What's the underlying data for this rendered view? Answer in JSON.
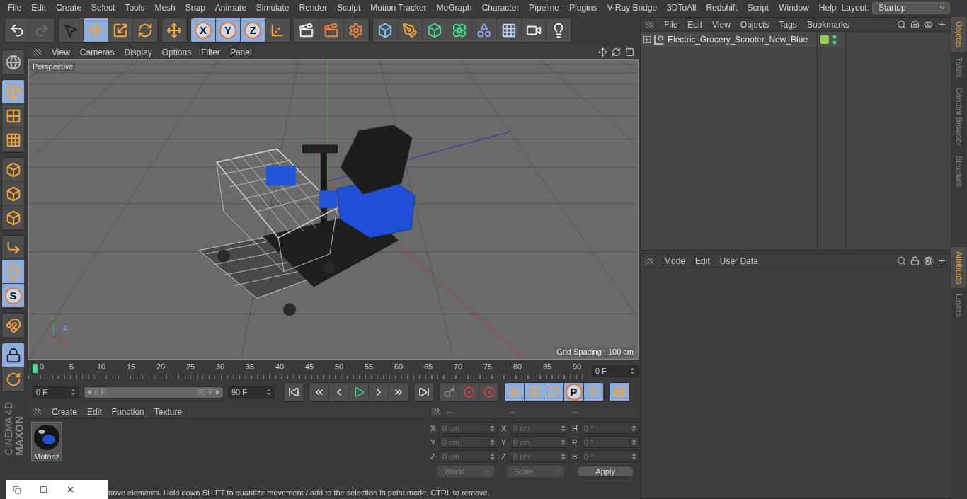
{
  "menu_bar": {
    "items": [
      "File",
      "Edit",
      "Create",
      "Select",
      "Tools",
      "Mesh",
      "Snap",
      "Animate",
      "Simulate",
      "Render",
      "Sculpt",
      "Motion Tracker",
      "MoGraph",
      "Character",
      "Pipeline",
      "Plugins",
      "V-Ray Bridge",
      "3DToAll",
      "Redshift",
      "Script",
      "Window",
      "Help"
    ],
    "layout_label": "Layout:",
    "layout_value": "Startup"
  },
  "toolbar": {
    "groups": [
      {
        "buttons": [
          {
            "kind": "undo",
            "selected": false
          },
          {
            "kind": "redo",
            "selected": false
          }
        ]
      },
      {
        "buttons": [
          {
            "kind": "select",
            "selected": false
          },
          {
            "kind": "move",
            "selected": true
          },
          {
            "kind": "scale",
            "selected": false
          },
          {
            "kind": "rotate",
            "selected": false
          }
        ]
      },
      {
        "buttons": [
          {
            "kind": "move",
            "selected": false
          }
        ]
      },
      {
        "buttons": [
          {
            "kind": "letter",
            "label": "X",
            "selected": true
          },
          {
            "kind": "letter",
            "label": "Y",
            "selected": true
          },
          {
            "kind": "letter",
            "label": "Z",
            "selected": true
          },
          {
            "kind": "coord",
            "selected": false
          }
        ]
      },
      {
        "buttons": [
          {
            "kind": "render-view",
            "selected": false
          },
          {
            "kind": "render-pic",
            "selected": false
          },
          {
            "kind": "render-settings",
            "selected": false
          }
        ]
      },
      {
        "buttons": [
          {
            "kind": "cube",
            "selected": false
          },
          {
            "kind": "pen",
            "selected": false
          },
          {
            "kind": "subdivision",
            "selected": false
          },
          {
            "kind": "cloner",
            "selected": false
          },
          {
            "kind": "deformer",
            "selected": false
          },
          {
            "kind": "floor",
            "selected": false
          },
          {
            "kind": "camera",
            "selected": false
          },
          {
            "kind": "light",
            "selected": false
          }
        ]
      }
    ]
  },
  "left_tools": {
    "groups": [
      {
        "buttons": [
          {
            "kind": "globe",
            "selected": false
          }
        ]
      },
      {
        "buttons": [
          {
            "kind": "model",
            "selected": true
          },
          {
            "kind": "texture",
            "selected": false
          },
          {
            "kind": "workplane",
            "selected": false
          }
        ]
      },
      {
        "buttons": [
          {
            "kind": "points",
            "selected": false
          },
          {
            "kind": "edges",
            "selected": false
          },
          {
            "kind": "polygons",
            "selected": false
          }
        ]
      },
      {
        "buttons": [
          {
            "kind": "axis",
            "selected": false
          },
          {
            "kind": "tweak",
            "selected": true
          },
          {
            "kind": "letter",
            "label": "S",
            "selected": true
          }
        ]
      },
      {
        "buttons": [
          {
            "kind": "magnet",
            "selected": false
          }
        ]
      },
      {
        "buttons": [
          {
            "kind": "lock-grid",
            "selected": true
          },
          {
            "kind": "grid-rotate",
            "selected": false
          }
        ]
      }
    ]
  },
  "logo": {
    "brand": "MAXON",
    "product": "CINEMA 4D"
  },
  "viewport": {
    "menu": [
      "View",
      "Cameras",
      "Display",
      "Options",
      "Filter",
      "Panel"
    ],
    "camera": "Perspective",
    "grid_spacing": "Grid Spacing : 100 cm",
    "axis_labels": [
      "Y",
      "Z",
      "X"
    ]
  },
  "timeline": {
    "ticks": [
      "0",
      "5",
      "10",
      "15",
      "20",
      "25",
      "30",
      "35",
      "40",
      "45",
      "50",
      "55",
      "60",
      "65",
      "70",
      "75",
      "80",
      "85",
      "90"
    ],
    "current_frame": "0 F"
  },
  "playback": {
    "start": "0 F",
    "range": {
      "start": "0 F",
      "end": "90 F",
      "level": 1
    },
    "end": "90 F",
    "groups": [
      {
        "buttons": [
          {
            "kind": "go-start",
            "selected": false
          }
        ]
      },
      {
        "buttons": [
          {
            "kind": "prev-key",
            "selected": false
          },
          {
            "kind": "prev-frame",
            "selected": false
          },
          {
            "kind": "play",
            "selected": false
          },
          {
            "kind": "next-frame",
            "selected": false
          },
          {
            "kind": "next-key",
            "selected": false
          }
        ]
      },
      {
        "buttons": [
          {
            "kind": "go-end",
            "selected": false
          }
        ]
      },
      {
        "buttons": [
          {
            "kind": "record",
            "selected": false
          },
          {
            "kind": "autokey",
            "selected": false
          },
          {
            "kind": "keysel",
            "selected": false
          }
        ]
      },
      {
        "buttons": [
          {
            "kind": "move",
            "selected": true
          },
          {
            "kind": "scale",
            "selected": true
          },
          {
            "kind": "rotate",
            "selected": true
          },
          {
            "kind": "letter",
            "label": "P",
            "selected": true
          },
          {
            "kind": "pla",
            "selected": true
          }
        ]
      },
      {
        "buttons": [
          {
            "kind": "film",
            "selected": true
          }
        ]
      }
    ]
  },
  "materials": {
    "menu": [
      "Create",
      "Edit",
      "Function",
      "Texture"
    ],
    "items": [
      {
        "name": "Motoriz"
      }
    ]
  },
  "coordinates": {
    "headers": [
      "--",
      "--",
      "--"
    ],
    "rows": [
      [
        {
          "axis": "X",
          "value": "0 cm"
        },
        {
          "axis": "X",
          "value": "0 cm"
        },
        {
          "axis": "H",
          "value": "0 °"
        }
      ],
      [
        {
          "axis": "Y",
          "value": "0 cm"
        },
        {
          "axis": "Y",
          "value": "0 cm"
        },
        {
          "axis": "P",
          "value": "0 °"
        }
      ],
      [
        {
          "axis": "Z",
          "value": "0 cm"
        },
        {
          "axis": "Z",
          "value": "0 cm"
        },
        {
          "axis": "B",
          "value": "0 °"
        }
      ]
    ],
    "dropdowns": [
      "World",
      "Scale"
    ],
    "apply": "Apply"
  },
  "status_bar": "move elements. Hold down SHIFT to quantize movement / add to the selection in point mode, CTRL to remove.",
  "objects_panel": {
    "menu": [
      "File",
      "Edit",
      "View",
      "Objects",
      "Tags",
      "Bookmarks"
    ],
    "objects": [
      {
        "name": "Electric_Grocery_Scooter_New_Blue",
        "expanded": false,
        "color": "#8fd14f"
      }
    ]
  },
  "attributes_panel": {
    "menu": [
      "Mode",
      "Edit",
      "User Data"
    ]
  },
  "side_tabs": {
    "top": [
      {
        "label": "Objects",
        "selected": true
      },
      {
        "label": "Takes",
        "selected": false
      },
      {
        "label": "Content Browser",
        "selected": false
      },
      {
        "label": "Structure",
        "selected": false
      }
    ],
    "bottom": [
      {
        "label": "Attributes",
        "selected": true
      },
      {
        "label": "Layers",
        "selected": false
      }
    ]
  }
}
